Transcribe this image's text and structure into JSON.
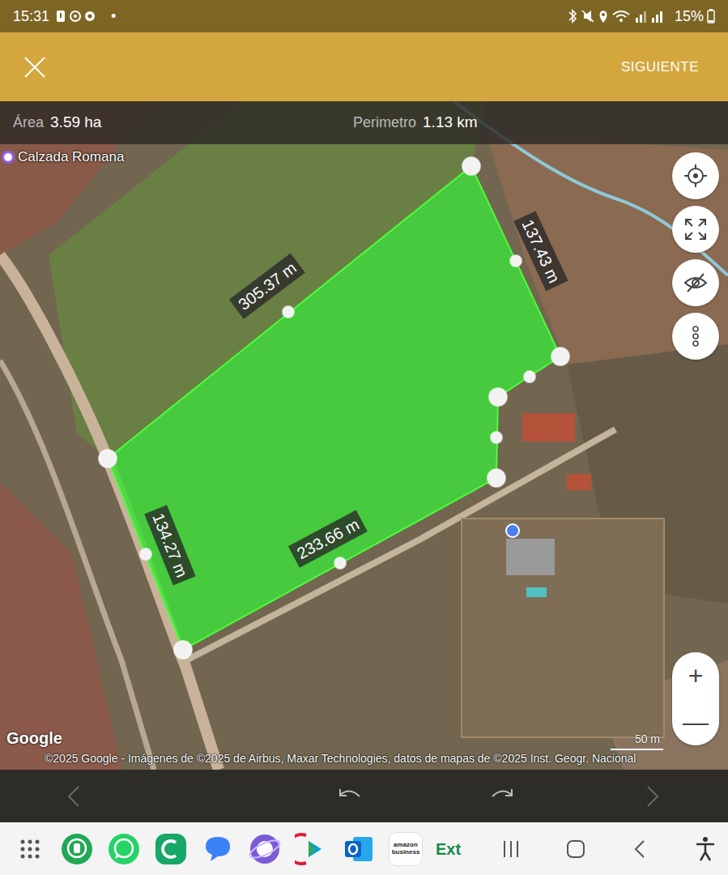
{
  "status_bar": {
    "time": "15:31",
    "dot": "•",
    "battery": "15%"
  },
  "app_bar": {
    "action": "SIGUIENTE"
  },
  "measurement": {
    "area_label": "Área",
    "area_value": "3.59 ha",
    "perimeter_label": "Perimetro",
    "perimeter_value": "1.13 km"
  },
  "map": {
    "place_label": "Calzada Romana",
    "edge_labels": [
      "305.37 m",
      "137.43 m",
      "233.66 m",
      "134.27 m"
    ],
    "zoom_in": "+",
    "zoom_out": "—",
    "logo": "Google",
    "attribution": "©2025 Google - Imágenes de ©2025 de Airbus, Maxar Technologies, datos de mapas de ©2025 Inst. Geogr. Nacional",
    "scale": "50 m"
  },
  "toolbar": {
    "previous": {
      "disabled": true
    },
    "undo": {
      "disabled": false
    },
    "redo": {
      "disabled": false
    },
    "next": {
      "disabled": true
    }
  },
  "nav_bar": {
    "amazon_label": "amazon business",
    "ext_label": "Ext"
  }
}
